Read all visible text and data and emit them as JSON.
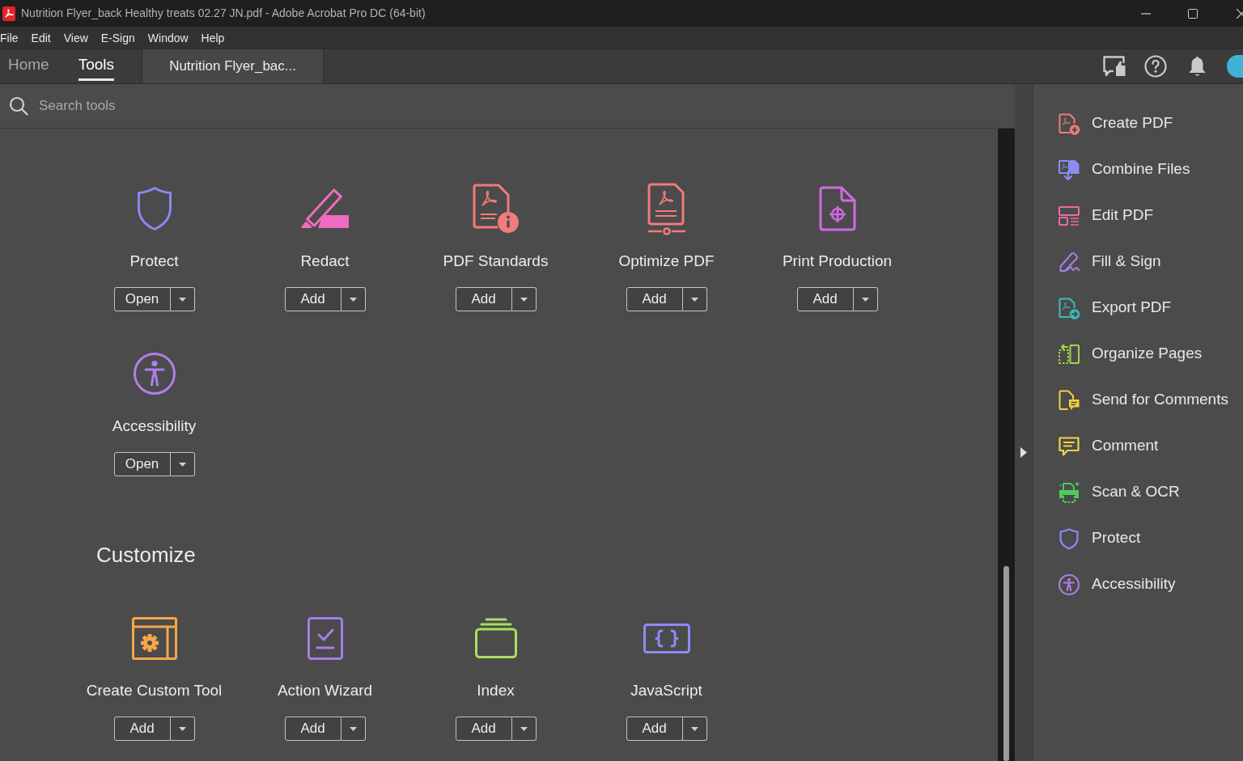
{
  "window": {
    "title": "Nutrition Flyer_back Healthy treats 02.27 JN.pdf - Adobe Acrobat Pro DC (64-bit)"
  },
  "menu_bar": [
    "File",
    "Edit",
    "View",
    "E-Sign",
    "Window",
    "Help"
  ],
  "tabs": [
    {
      "label": "Home",
      "selected": false
    },
    {
      "label": "Tools",
      "selected": true
    }
  ],
  "document_tab": {
    "label": "Nutrition Flyer_bac..."
  },
  "search": {
    "placeholder": "Search tools"
  },
  "sections": [
    {
      "tools": [
        {
          "label": "Protect",
          "button": "Open"
        },
        {
          "label": "Redact",
          "button": "Add"
        },
        {
          "label": "PDF Standards",
          "button": "Add"
        },
        {
          "label": "Optimize PDF",
          "button": "Add"
        },
        {
          "label": "Print Production",
          "button": "Add"
        },
        {
          "label": "Accessibility",
          "button": "Open"
        }
      ]
    },
    {
      "heading": "Customize",
      "tools": [
        {
          "label": "Create Custom Tool",
          "button": "Add"
        },
        {
          "label": "Action Wizard",
          "button": "Add"
        },
        {
          "label": "Index",
          "button": "Add"
        },
        {
          "label": "JavaScript",
          "button": "Add"
        }
      ]
    }
  ],
  "right_panel": {
    "items": [
      {
        "label": "Create PDF"
      },
      {
        "label": "Combine Files"
      },
      {
        "label": "Edit PDF"
      },
      {
        "label": "Fill & Sign"
      },
      {
        "label": "Export PDF"
      },
      {
        "label": "Organize Pages"
      },
      {
        "label": "Send for Comments"
      },
      {
        "label": "Comment"
      },
      {
        "label": "Scan & OCR"
      },
      {
        "label": "Protect"
      },
      {
        "label": "Accessibility"
      }
    ]
  }
}
